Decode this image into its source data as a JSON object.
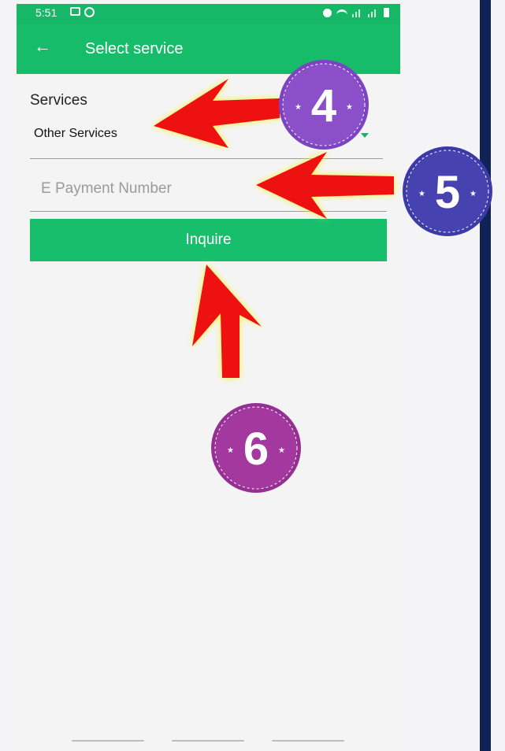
{
  "statusbar": {
    "time": "5:51"
  },
  "appbar": {
    "title": "Select service"
  },
  "form": {
    "services_label": "Services",
    "service_selected": "Other Services",
    "epayment_placeholder": "E Payment Number",
    "inquire_label": "Inquire"
  },
  "annotations": {
    "step_dropdown": "4",
    "step_input": "5",
    "step_button": "6",
    "badge_color_4": "#8a4fc9",
    "badge_color_5": "#4643b0",
    "badge_color_6": "#a3399f",
    "arrow_color": "#ee1111",
    "arrow_glow": "#f6f22a"
  },
  "colors": {
    "primary_green": "#17bc6b",
    "rail": "#0f2356"
  }
}
